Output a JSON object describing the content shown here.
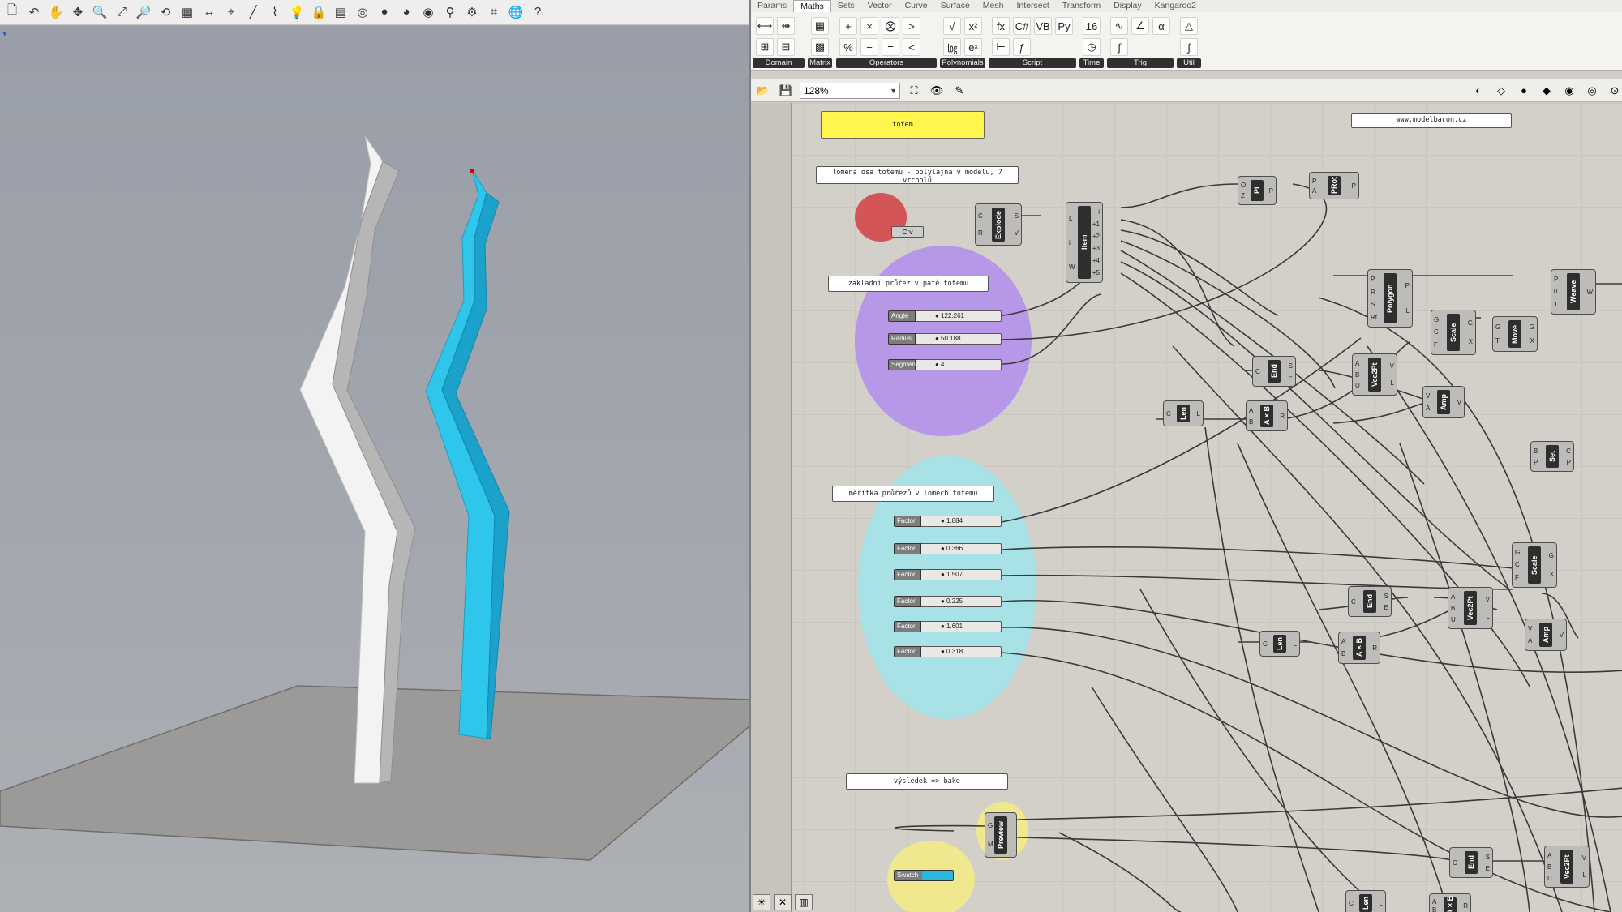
{
  "rhino": {
    "toolbar_icons": [
      "new-file-icon",
      "undo-icon",
      "pan-icon",
      "move-icon",
      "zoom-window-icon",
      "zoom-extents-icon",
      "zoom-selected-icon",
      "rotate-view-icon",
      "four-viewports-icon",
      "dimension-icon",
      "named-view-icon",
      "line-icon",
      "polyline-icon",
      "bulb-icon",
      "lock-icon",
      "layer-icon",
      "color-wheel-icon",
      "shaded-icon",
      "rendered-icon",
      "material-icon",
      "filter-icon",
      "options-icon",
      "snap-icon",
      "world-icon",
      "help-icon"
    ],
    "viewport_title": "▾"
  },
  "gh": {
    "menu_tabs": [
      "Params",
      "Maths",
      "Sets",
      "Vector",
      "Curve",
      "Surface",
      "Mesh",
      "Intersect",
      "Transform",
      "Display",
      "Kangaroo2"
    ],
    "active_tab": "Maths",
    "ribbon_groups": [
      {
        "label": "Domain",
        "icons": [
          "domain-icon",
          "domain-2-icon",
          "construct-domain-icon",
          "deconstruct-domain-icon"
        ]
      },
      {
        "label": "Matrix",
        "icons": [
          "matrix-icon",
          "matrix-2-icon"
        ]
      },
      {
        "label": "Operators",
        "icons": [
          "addition-icon",
          "multiplication-icon",
          "gate-icon",
          "larger-icon",
          "modulus-icon",
          "subtract-icon",
          "equals-icon",
          "smaller-icon"
        ]
      },
      {
        "label": "Polynomials",
        "icons": [
          "square-root-icon",
          "power-icon",
          "log-icon",
          "exponent-icon"
        ]
      },
      {
        "label": "Script",
        "icons": [
          "expression-icon",
          "csharp-icon",
          "vb-icon",
          "python-icon",
          "eval-icon",
          "fx-icon"
        ]
      },
      {
        "label": "Time",
        "icons": [
          "calendar-icon",
          "clock-icon"
        ]
      },
      {
        "label": "Trig",
        "icons": [
          "sine-icon",
          "angle-icon",
          "alpha-icon",
          "integral-icon"
        ]
      },
      {
        "label": "Util",
        "icons": [
          "util-icon",
          "util-2-icon"
        ]
      }
    ],
    "zoom": "128%",
    "panels": {
      "totem": "totem",
      "website": "www.modelbaron.cz",
      "axis_note": "lomená osa totemu - polylajna v modelu, 7 vrcholů",
      "base_note": "základní průřez v patě totemu",
      "scales_note": "měřítka průřezů v lomech totemu",
      "result_note": "výsledek => bake"
    },
    "crv_param": "Crv",
    "sliders_base": [
      {
        "label": "Angle",
        "value": "122.261"
      },
      {
        "label": "Radius",
        "value": "50.188"
      },
      {
        "label": "Segments",
        "value": "4"
      }
    ],
    "sliders_factor": [
      {
        "label": "Factor",
        "value": "1.884"
      },
      {
        "label": "Factor",
        "value": "0.366"
      },
      {
        "label": "Factor",
        "value": "1.507"
      },
      {
        "label": "Factor",
        "value": "0.225"
      },
      {
        "label": "Factor",
        "value": "1.601"
      },
      {
        "label": "Factor",
        "value": "0.318"
      }
    ],
    "swatch_label": "Swatch",
    "swatch_color": "#29b7e0",
    "components": {
      "explode": {
        "name": "Explode",
        "ins": [
          "C",
          "R"
        ],
        "outs": [
          "S",
          "V"
        ]
      },
      "item": {
        "name": "Item",
        "ins": [
          "L",
          "i",
          "W"
        ],
        "outs": [
          "i",
          "+1",
          "+2",
          "+3",
          "+4",
          "+5"
        ]
      },
      "pl": {
        "name": "Pl",
        "ins": [
          "O",
          "Z"
        ],
        "outs": [
          "P"
        ]
      },
      "prot": {
        "name": "PRot",
        "ins": [
          "P",
          "A"
        ],
        "outs": [
          "P"
        ]
      },
      "polygon": {
        "name": "Polygon",
        "ins": [
          "P",
          "R",
          "S",
          "Rf"
        ],
        "outs": [
          "P",
          "L"
        ]
      },
      "scale1": {
        "name": "Scale",
        "ins": [
          "G",
          "C",
          "F"
        ],
        "outs": [
          "G",
          "X"
        ]
      },
      "move": {
        "name": "Move",
        "ins": [
          "G",
          "T"
        ],
        "outs": [
          "G",
          "X"
        ]
      },
      "weave": {
        "name": "Weave",
        "ins": [
          "P",
          "0",
          "1"
        ],
        "outs": [
          "W"
        ]
      },
      "end1": {
        "name": "End",
        "ins": [
          "C"
        ],
        "outs": [
          "S",
          "E"
        ]
      },
      "vec2pt1": {
        "name": "Vec2Pt",
        "ins": [
          "A",
          "B",
          "U"
        ],
        "outs": [
          "V",
          "L"
        ]
      },
      "amp1": {
        "name": "Amp",
        "ins": [
          "V",
          "A"
        ],
        "outs": [
          "V"
        ]
      },
      "len1": {
        "name": "Len",
        "ins": [
          "C"
        ],
        "outs": [
          "L"
        ]
      },
      "axb1": {
        "name": "A×B",
        "ins": [
          "A",
          "B"
        ],
        "outs": [
          "R"
        ]
      },
      "set": {
        "name": "Set",
        "ins": [
          "B",
          "P"
        ],
        "outs": [
          "C",
          "P"
        ]
      },
      "scale2": {
        "name": "Scale",
        "ins": [
          "G",
          "C",
          "F"
        ],
        "outs": [
          "G",
          "X"
        ]
      },
      "end2": {
        "name": "End",
        "ins": [
          "C"
        ],
        "outs": [
          "S",
          "E"
        ]
      },
      "vec2pt2": {
        "name": "Vec2Pt",
        "ins": [
          "A",
          "B",
          "U"
        ],
        "outs": [
          "V",
          "L"
        ]
      },
      "amp2": {
        "name": "Amp",
        "ins": [
          "V",
          "A"
        ],
        "outs": [
          "V"
        ]
      },
      "len2": {
        "name": "Len",
        "ins": [
          "C"
        ],
        "outs": [
          "L"
        ]
      },
      "axb2": {
        "name": "A×B",
        "ins": [
          "A",
          "B"
        ],
        "outs": [
          "R"
        ]
      },
      "preview": {
        "name": "Preview",
        "ins": [
          "G",
          "M"
        ],
        "outs": []
      },
      "end3": {
        "name": "End",
        "ins": [
          "C"
        ],
        "outs": [
          "S",
          "E"
        ]
      },
      "vec2pt3": {
        "name": "Vec2Pt",
        "ins": [
          "A",
          "B",
          "U"
        ],
        "outs": [
          "V",
          "L"
        ]
      },
      "len3": {
        "name": "Len",
        "ins": [
          "C"
        ],
        "outs": [
          "L"
        ]
      },
      "axb3": {
        "name": "A×B",
        "ins": [
          "A",
          "B"
        ],
        "outs": [
          "R"
        ]
      }
    },
    "bottom_icons": [
      "sun-icon",
      "close-icon",
      "chart-icon"
    ]
  }
}
